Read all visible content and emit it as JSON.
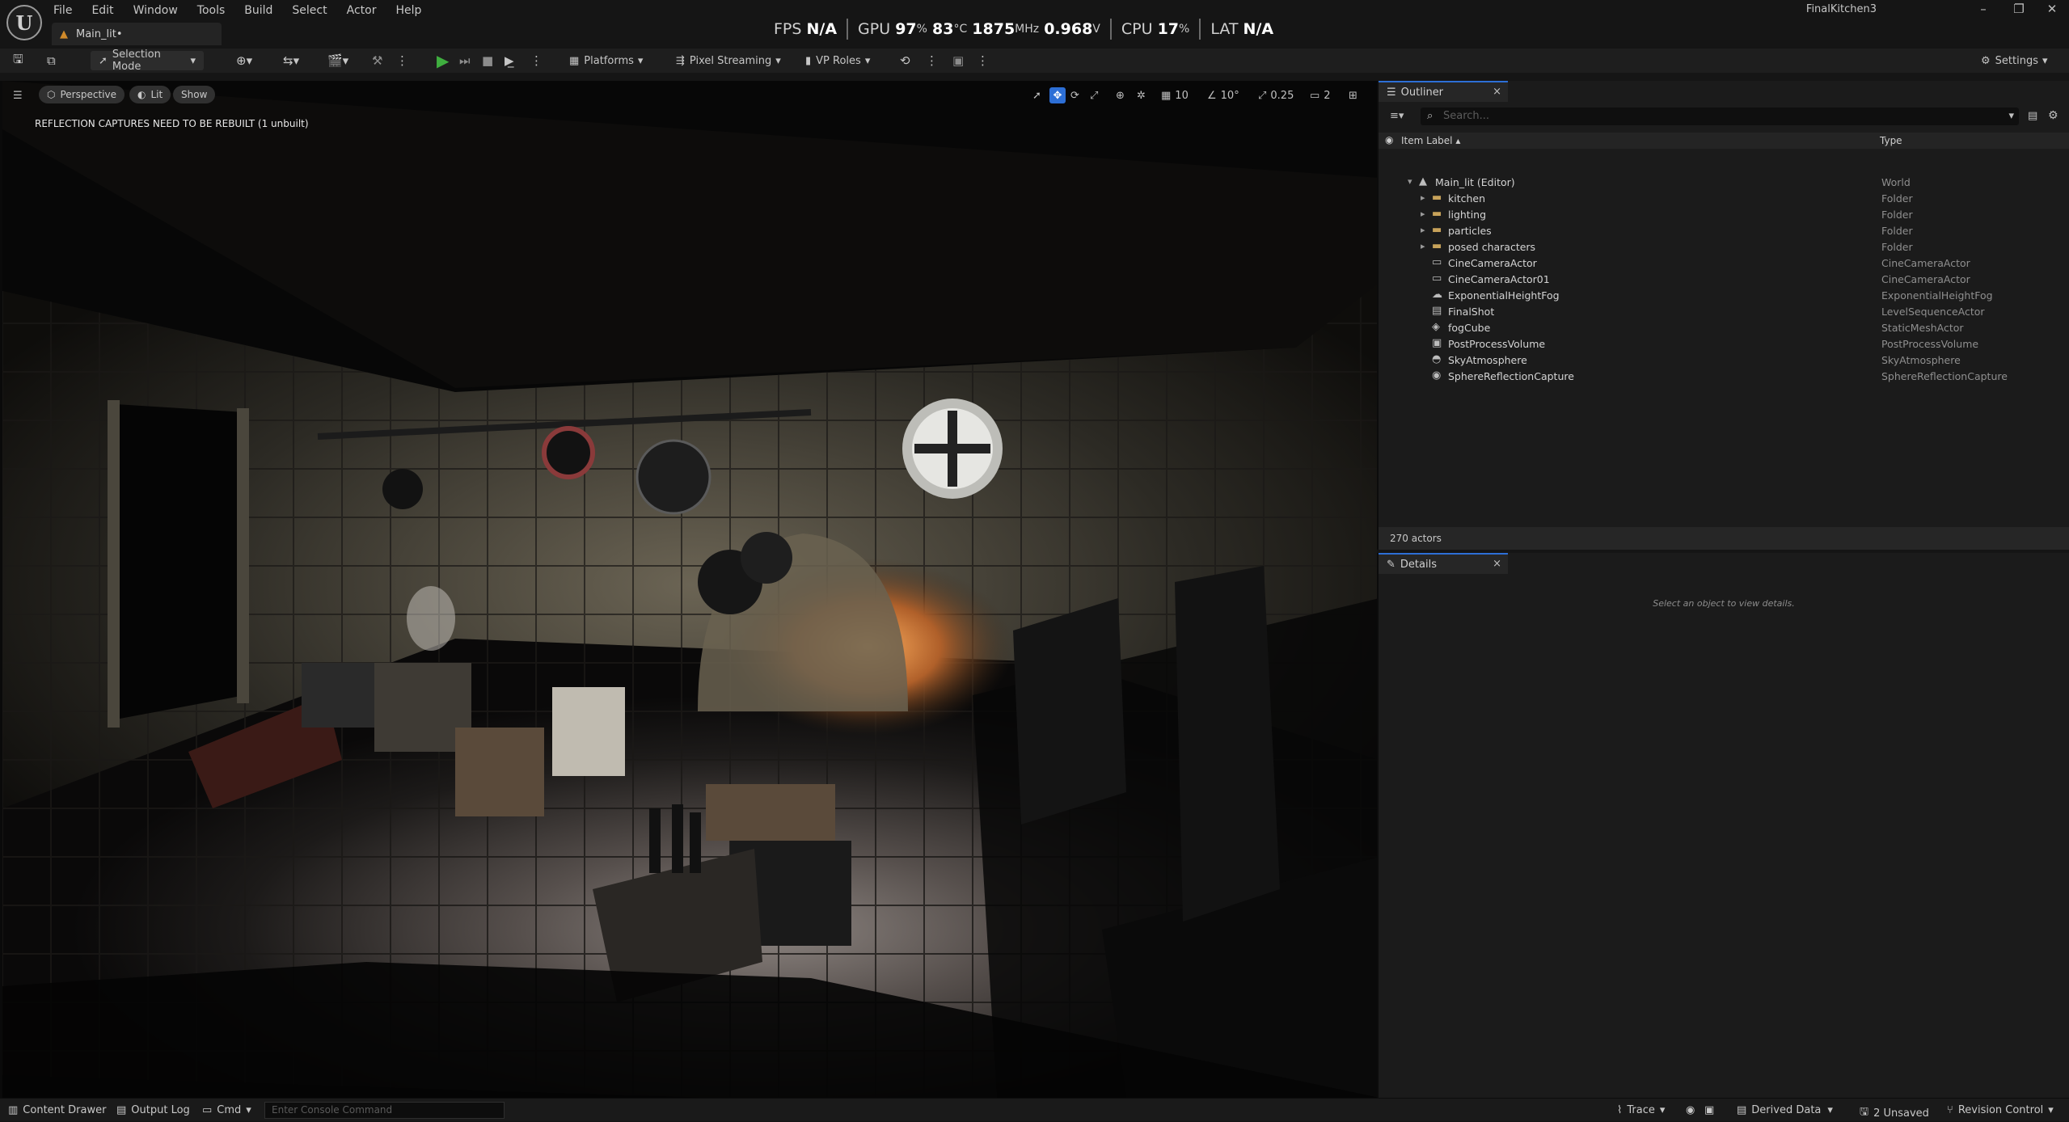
{
  "app": {
    "logo": "U",
    "project": "FinalKitchen3",
    "doc_tab": "Main_lit•"
  },
  "menu": [
    "File",
    "Edit",
    "Window",
    "Tools",
    "Build",
    "Select",
    "Actor",
    "Help"
  ],
  "stats": {
    "fps_label": "FPS",
    "fps": "N/A",
    "gpu_label": "GPU",
    "gpu_load": "97",
    "gpu_temp": "83",
    "gpu_temp_unit": "°C",
    "gpu_clock": "1875",
    "gpu_clock_unit": "MHz",
    "gpu_volt": "0.968",
    "gpu_volt_unit": "V",
    "pct": "%",
    "cpu_label": "CPU",
    "cpu_load": "17",
    "lat_label": "LAT",
    "lat": "N/A"
  },
  "toolbar": {
    "selection_mode": "Selection Mode",
    "platforms": "Platforms",
    "pixel_streaming": "Pixel Streaming",
    "vp_roles": "VP Roles",
    "settings": "Settings"
  },
  "viewport": {
    "perspective": "Perspective",
    "lit": "Lit",
    "show": "Show",
    "warning": "REFLECTION CAPTURES NEED TO BE REBUILT (1 unbuilt)",
    "grid_snap": "10",
    "rot_snap": "10°",
    "scale_snap": "0.25",
    "cam_speed": "2"
  },
  "outliner": {
    "title": "Outliner",
    "search_placeholder": "Search...",
    "col_label": "Item Label",
    "col_type": "Type",
    "actor_count": "270 actors",
    "rows": [
      {
        "label": "Main_lit (Editor)",
        "type": "World",
        "icon": "world-icon"
      },
      {
        "label": "kitchen",
        "type": "Folder",
        "icon": "folder-icon"
      },
      {
        "label": "lighting",
        "type": "Folder",
        "icon": "folder-icon"
      },
      {
        "label": "particles",
        "type": "Folder",
        "icon": "folder-icon"
      },
      {
        "label": "posed characters",
        "type": "Folder",
        "icon": "folder-icon"
      },
      {
        "label": "CineCameraActor",
        "type": "CineCameraActor",
        "icon": "camera-icon"
      },
      {
        "label": "CineCameraActor01",
        "type": "CineCameraActor",
        "icon": "camera-icon"
      },
      {
        "label": "ExponentialHeightFog",
        "type": "ExponentialHeightFog",
        "icon": "fog-icon"
      },
      {
        "label": "FinalShot",
        "type": "LevelSequenceActor",
        "icon": "sequence-icon"
      },
      {
        "label": "fogCube",
        "type": "StaticMeshActor",
        "icon": "mesh-icon"
      },
      {
        "label": "PostProcessVolume",
        "type": "PostProcessVolume",
        "icon": "volume-icon"
      },
      {
        "label": "SkyAtmosphere",
        "type": "SkyAtmosphere",
        "icon": "sky-icon"
      },
      {
        "label": "SphereReflectionCapture",
        "type": "SphereReflectionCapture",
        "icon": "reflection-icon"
      }
    ]
  },
  "details": {
    "title": "Details",
    "empty": "Select an object to view details."
  },
  "statusbar": {
    "content_drawer": "Content Drawer",
    "output_log": "Output Log",
    "cmd": "Cmd",
    "console_placeholder": "Enter Console Command",
    "trace": "Trace",
    "derived_data": "Derived Data",
    "unsaved": "2 Unsaved",
    "revision_control": "Revision Control"
  },
  "colors": {
    "accent": "#2d6fd6",
    "play": "#3fae3f",
    "folder": "#c7a25a"
  }
}
